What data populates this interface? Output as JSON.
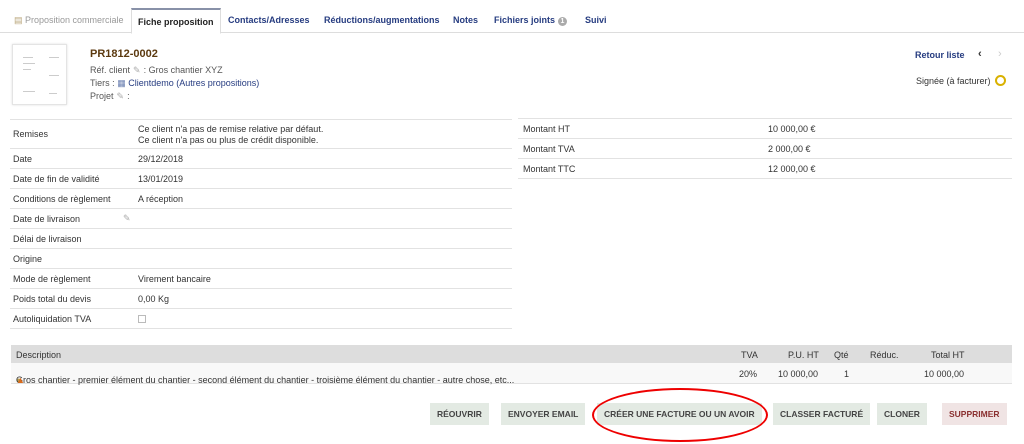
{
  "tabs": [
    {
      "label": "Proposition commerciale"
    },
    {
      "label": "Fiche proposition"
    },
    {
      "label": "Contacts/Adresses"
    },
    {
      "label": "Réductions/augmentations"
    },
    {
      "label": "Notes"
    },
    {
      "label": "Fichiers joints",
      "badge": "1"
    },
    {
      "label": "Suivi"
    }
  ],
  "header": {
    "ref": "PR1812-0002",
    "ref_client_label": "Réf. client",
    "ref_client_value": ": Gros chantier XYZ",
    "tiers_label": "Tiers :",
    "tiers_name": "Clientdemo",
    "tiers_other": "(Autres propositions)",
    "projet_label": "Projet",
    "projet_value": ":",
    "back_label": "Retour liste",
    "status": "Signée (à facturer)",
    "status_color": "#d9b100"
  },
  "left_fields": [
    {
      "label": "Remises",
      "value": "Ce client n'a pas de remise relative par défaut.",
      "value2": "Ce client n'a pas ou plus de crédit disponible."
    },
    {
      "label": "Date",
      "value": "29/12/2018"
    },
    {
      "label": "Date de fin de validité",
      "value": "13/01/2019"
    },
    {
      "label": "Conditions de règlement",
      "value": "A réception"
    },
    {
      "label": "Date de livraison",
      "value": ""
    },
    {
      "label": "Délai de livraison",
      "value": ""
    },
    {
      "label": "Origine",
      "value": ""
    },
    {
      "label": "Mode de règlement",
      "value": "Virement bancaire"
    },
    {
      "label": "Poids total du devis",
      "value": "0,00 Kg"
    },
    {
      "label": "Autoliquidation TVA",
      "value": ""
    }
  ],
  "amounts": [
    {
      "label": "Montant HT",
      "value": "10 000,00 €"
    },
    {
      "label": "Montant TVA",
      "value": "2 000,00 €"
    },
    {
      "label": "Montant TTC",
      "value": "12 000,00 €"
    }
  ],
  "lines": {
    "headers": {
      "desc": "Description",
      "tva": "TVA",
      "pu": "P.U. HT",
      "qty": "Qté",
      "reduc": "Réduc.",
      "total": "Total HT"
    },
    "rows": [
      {
        "desc": "Gros chantier - premier élément du chantier - second élément du chantier - troisième élément du chantier - autre chose, etc...",
        "tva": "20%",
        "pu": "10 000,00",
        "qty": "1",
        "reduc": "",
        "total": "10 000,00"
      }
    ]
  },
  "buttons": {
    "reopen": "RÉOUVRIR",
    "email": "ENVOYER EMAIL",
    "invoice": "CRÉER UNE FACTURE OU UN AVOIR",
    "classify": "CLASSER FACTURÉ",
    "clone": "CLONER",
    "delete": "SUPPRIMER"
  }
}
